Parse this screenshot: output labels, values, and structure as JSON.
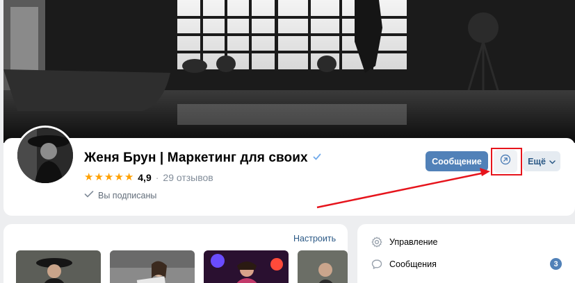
{
  "profile": {
    "name": "Женя Брун | Маркетинг для своих",
    "rating": "4,9",
    "separator": "·",
    "reviews": "29 отзывов",
    "subscribed": "Вы подписаны"
  },
  "actions": {
    "message": "Сообщение",
    "more": "Ещё"
  },
  "gallery": {
    "customize": "Настроить"
  },
  "side_menu": {
    "items": [
      {
        "label": "Управление",
        "icon": "gear-icon"
      },
      {
        "label": "Сообщения",
        "icon": "message-icon",
        "badge": "3"
      }
    ]
  },
  "colors": {
    "accent": "#5181b8",
    "link": "#2a5885",
    "star": "#ffa000",
    "annotation": "#e6141c"
  }
}
